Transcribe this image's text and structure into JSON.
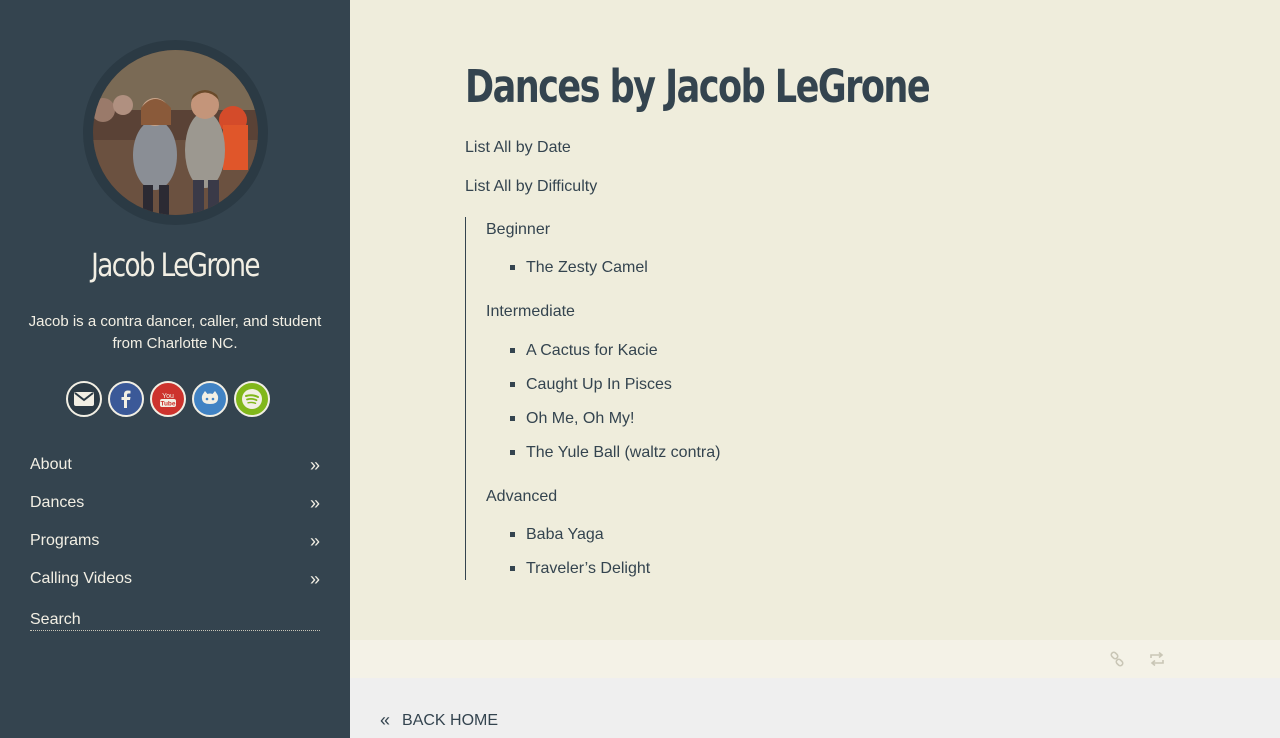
{
  "sidebar": {
    "name": "Jacob LeGrone",
    "bio": "Jacob is a contra dancer, caller, and student from Charlotte NC.",
    "social": [
      {
        "icon": "envelope-icon",
        "color": "#f2efe4"
      },
      {
        "icon": "facebook-icon",
        "color": "#3b5998"
      },
      {
        "icon": "youtube-icon",
        "color": "#cd332d"
      },
      {
        "icon": "github-icon",
        "color": "#4183c4"
      },
      {
        "icon": "spotify-icon",
        "color": "#81b71a"
      }
    ],
    "nav": [
      {
        "label": "About"
      },
      {
        "label": "Dances"
      },
      {
        "label": "Programs"
      },
      {
        "label": "Calling Videos"
      }
    ],
    "search_placeholder": "Search"
  },
  "main": {
    "title": "Dances by Jacob LeGrone",
    "list_by_date": "List All by Date",
    "list_by_difficulty": "List All by Difficulty",
    "groups": [
      {
        "heading": "Beginner",
        "dances": [
          "The Zesty Camel"
        ]
      },
      {
        "heading": "Intermediate",
        "dances": [
          "A Cactus for Kacie",
          "Caught Up In Pisces",
          "Oh Me, Oh My!",
          "The Yule Ball (waltz contra)"
        ]
      },
      {
        "heading": "Advanced",
        "dances": [
          "Baba Yaga",
          "Traveler’s Delight"
        ]
      }
    ]
  },
  "footer": {
    "back_home": "BACK HOME"
  },
  "colors": {
    "sidebar_bg": "#34444f",
    "content_bg": "#efeddc",
    "text": "#34444f"
  }
}
